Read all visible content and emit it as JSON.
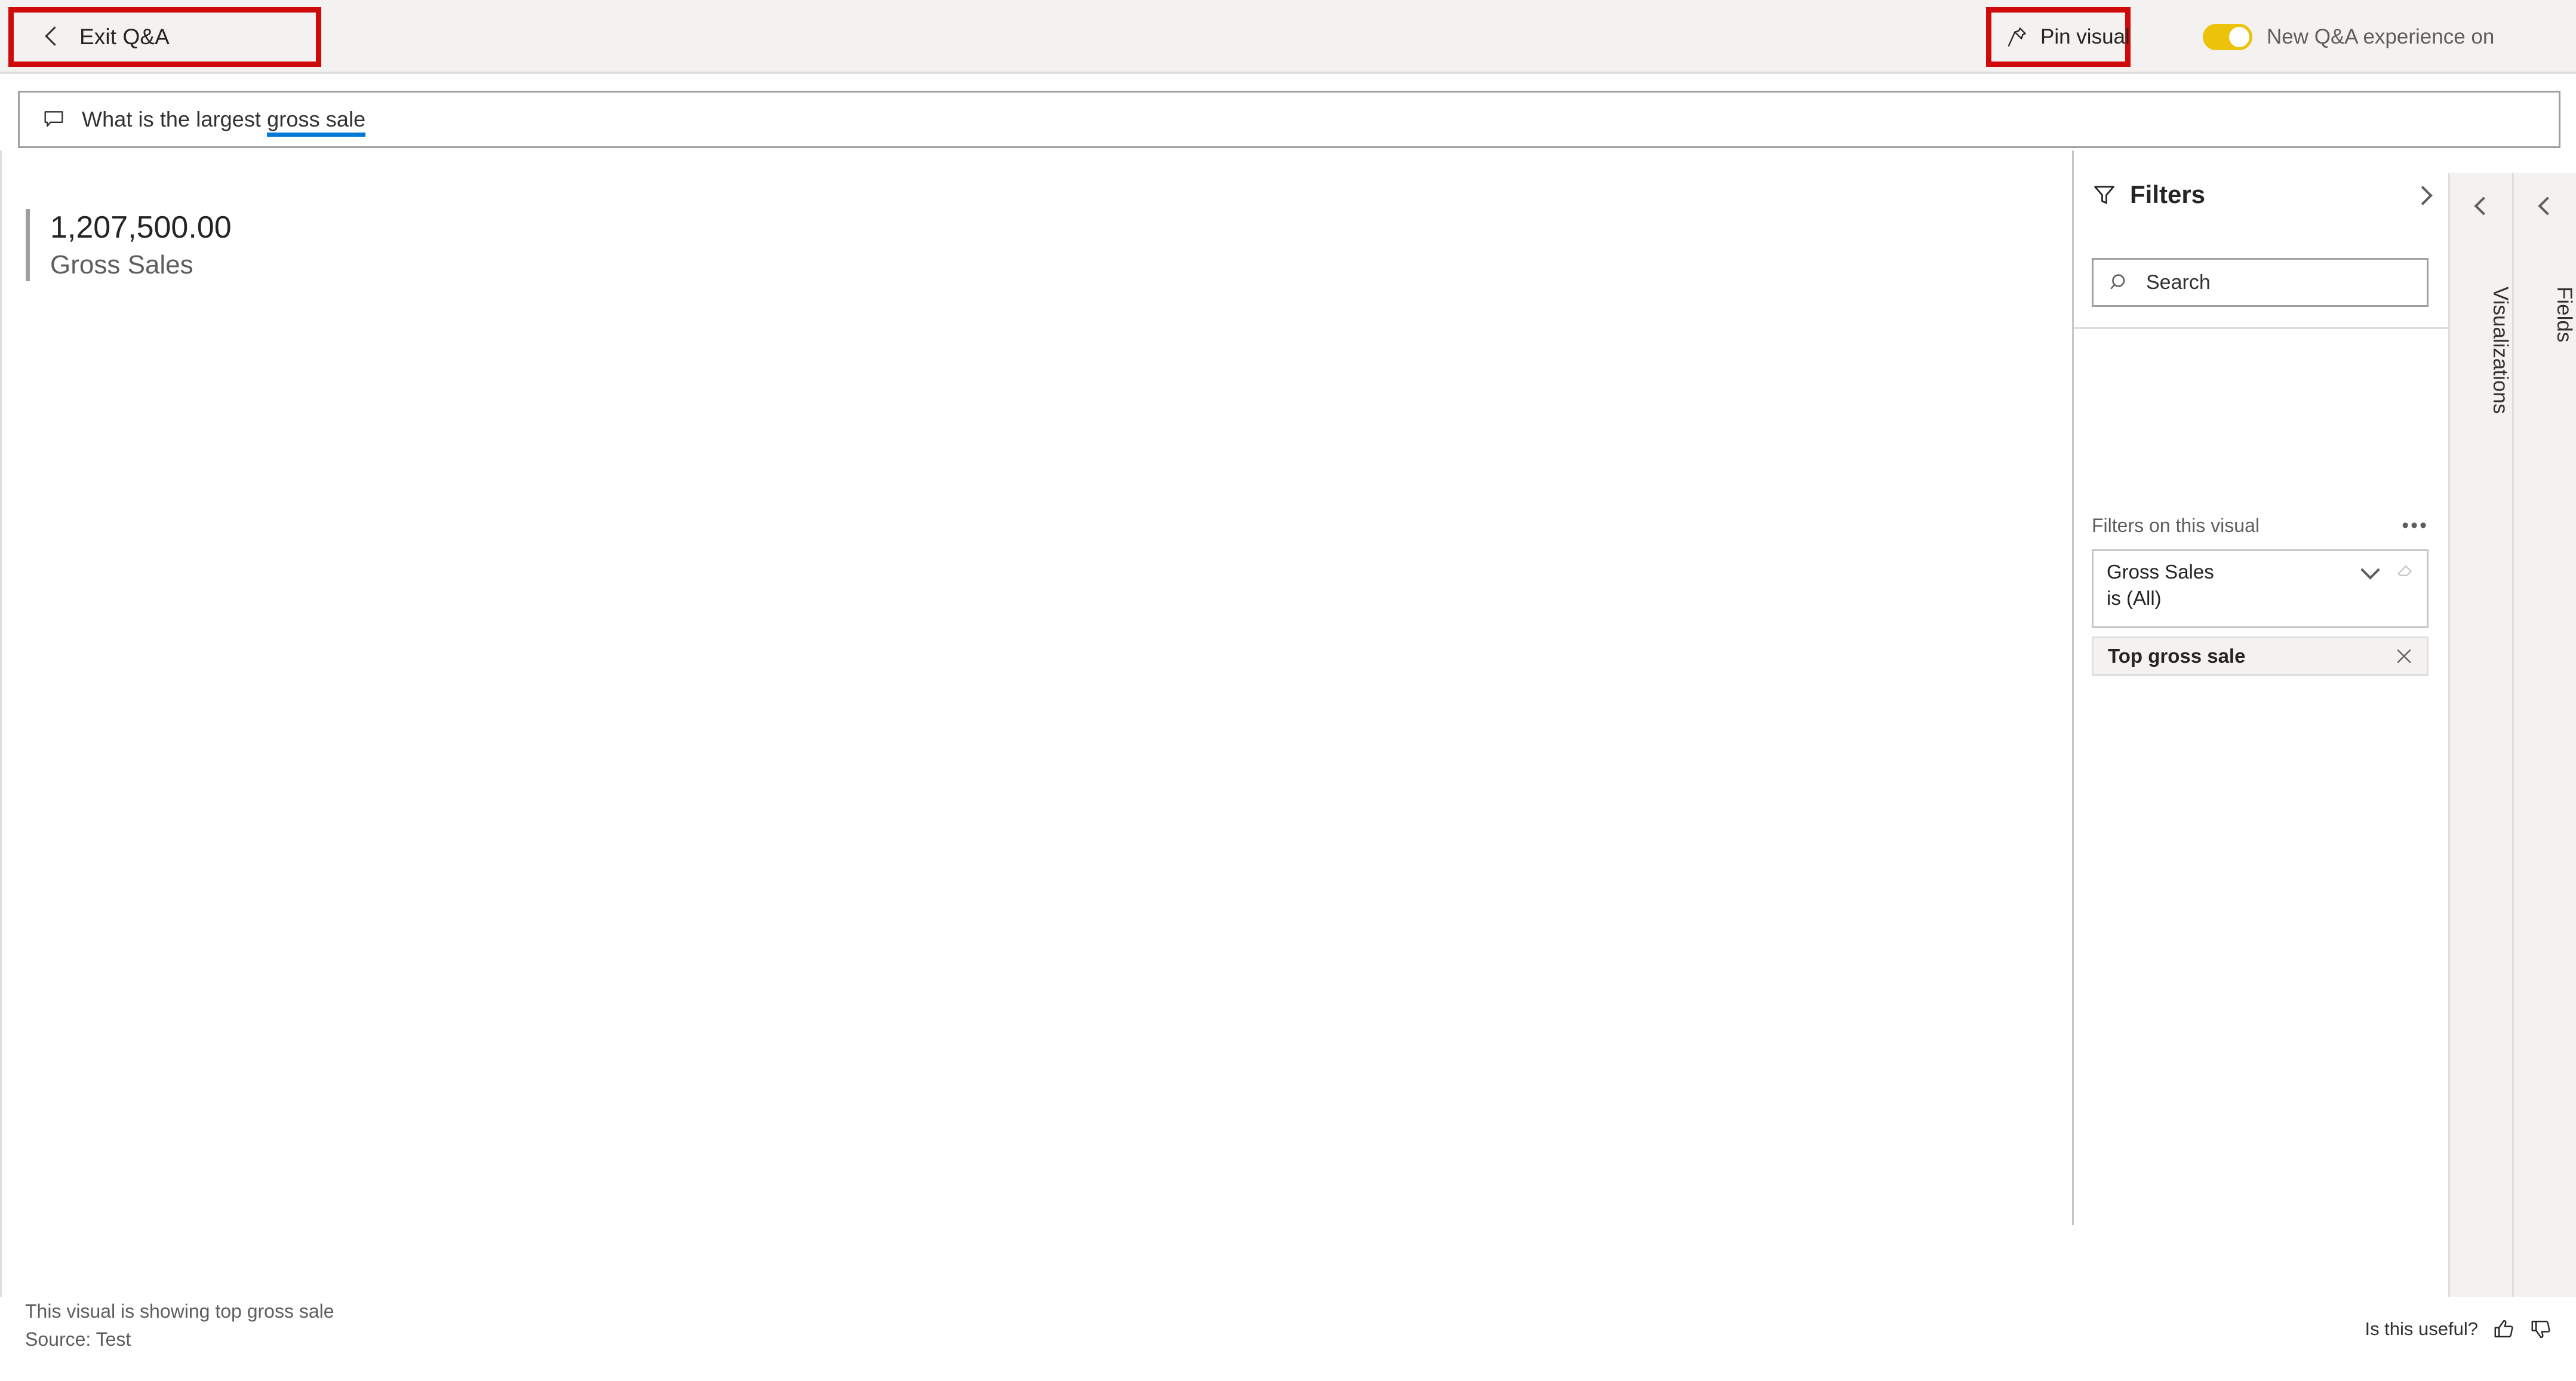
{
  "topbar": {
    "exit_label": "Exit Q&A",
    "exit_icon": "chevron-left-icon",
    "pin_label": "Pin visual",
    "pin_icon": "pin-icon",
    "toggle_label": "New Q&A experience on",
    "toggle_state": "on",
    "toggle_color": "#ecc20a",
    "annotation_color": "#cf0a0a",
    "background": "#f3f2f1"
  },
  "question_bar": {
    "icon": "speech-balloon-icon",
    "text_prefix": "What is the largest ",
    "text_term": "gross sale",
    "full_text": "What is the largest gross sale",
    "term_underline_color": "#0078d4"
  },
  "visual": {
    "value": "1,207,500.00",
    "caption": "Gross Sales",
    "accent_color": "#a19f9d"
  },
  "footer": {
    "description": "This visual is showing top gross sale",
    "source": "Source: Test",
    "useful_label": "Is this useful?",
    "thumb_up_icon": "thumbs-up-icon",
    "thumb_down_icon": "thumbs-down-icon"
  },
  "filters_pane": {
    "title": "Filters",
    "title_icon": "funnel-icon",
    "collapse_icon": "chevron-right-icon",
    "search_placeholder": "Search",
    "search_icon": "search-icon",
    "search_value": "",
    "section_label": "Filters on this visual",
    "more_options": "•••",
    "filter_card": {
      "field": "Gross Sales",
      "state": "is (All)",
      "expand_icon": "chevron-down-icon",
      "clear_icon": "eraser-icon"
    },
    "filter_chip": {
      "label": "Top gross sale",
      "close_icon": "close-icon"
    }
  },
  "side_panels": [
    {
      "label": "Visualizations",
      "expand_icon": "chevron-left-icon"
    },
    {
      "label": "Fields",
      "expand_icon": "chevron-left-icon"
    }
  ]
}
